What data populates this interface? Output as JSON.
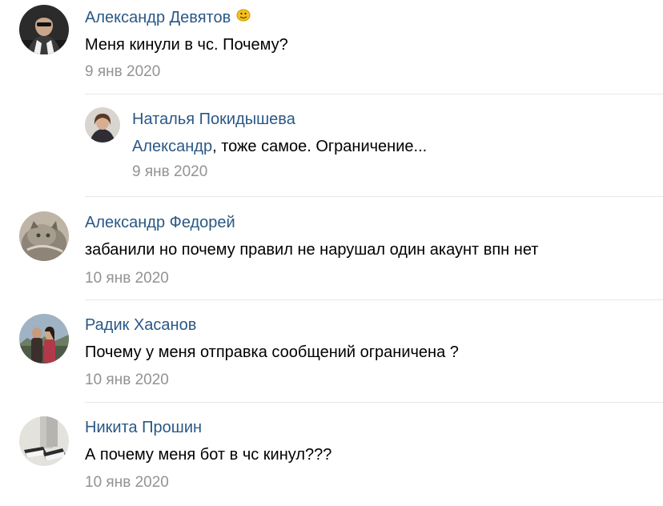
{
  "comments": [
    {
      "author": "Александр Девятов",
      "text": "Меня кинули в чс. Почему?",
      "date": "9 янв 2020",
      "badge_icon": "smiley-emoji-icon",
      "reply": {
        "author": "Наталья Покидышева",
        "mention": "Александр",
        "text": ", тоже самое. Ограничение...",
        "date": "9 янв 2020"
      }
    },
    {
      "author": "Александр Федорей",
      "text": "забанили но почему правил не нарушал один акаунт впн нет",
      "date": "10 янв 2020"
    },
    {
      "author": "Радик Хасанов",
      "text": "Почему у меня отправка сообщений ограничена ?",
      "date": "10 янв 2020"
    },
    {
      "author": "Никита Прошин",
      "text": "А почему меня бот в чс кинул???",
      "date": "10 янв 2020"
    }
  ],
  "colors": {
    "link": "#2a5885",
    "date": "#939393",
    "divider": "#e7e8ec"
  }
}
